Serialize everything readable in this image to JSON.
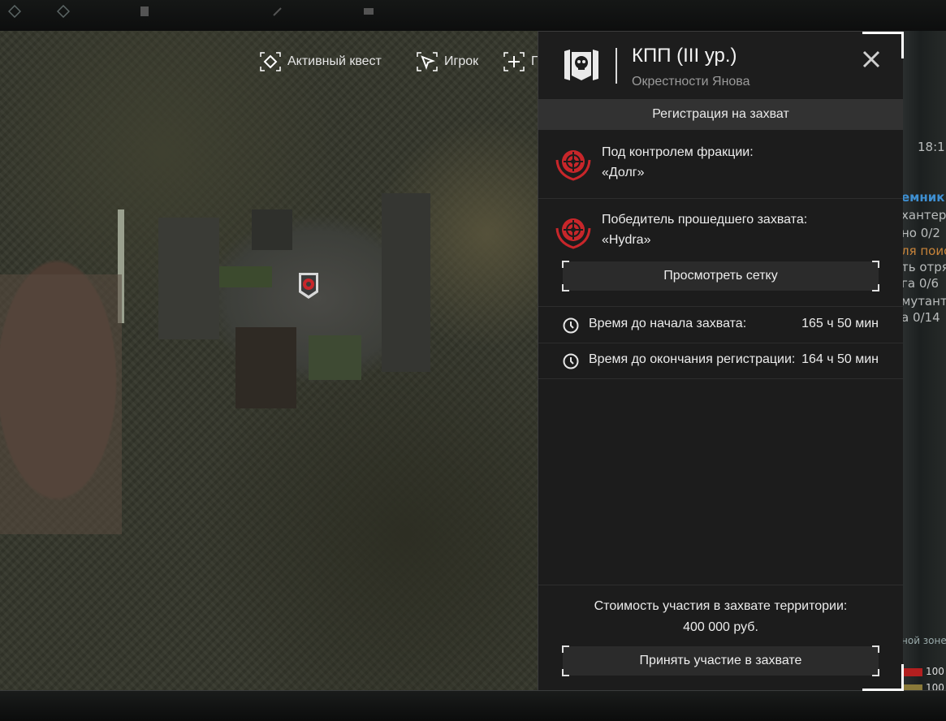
{
  "legend": [
    {
      "label": "Активный квест",
      "icon": "active-quest-icon"
    },
    {
      "label": "Игрок",
      "icon": "player-arrow-icon"
    },
    {
      "label": "Г",
      "icon": "plus-icon"
    }
  ],
  "panel": {
    "title": "КПП (III ур.)",
    "subtitle": "Окрестности Янова",
    "registration_header": "Регистрация на захват",
    "control": {
      "label": "Под контролем фракции:",
      "value": "«Долг»"
    },
    "winner": {
      "label": "Победитель прошедшего захвата:",
      "value": "«Hydra»"
    },
    "view_grid_button": "Просмотреть сетку",
    "timers": [
      {
        "label": "Время до начала захвата:",
        "value": "165 ч 50 мин"
      },
      {
        "label": "Время до окончания регистрации:",
        "value": "164 ч 50 мин"
      }
    ],
    "cost_label": "Стоимость участия в захвате территории:",
    "cost_value": "400 000 руб.",
    "join_button": "Принять участие в захвате"
  },
  "background_fragments": [
    {
      "text": "18:1"
    },
    {
      "text": "емник"
    },
    {
      "text": "хантеро"
    },
    {
      "text": "но 0/2"
    },
    {
      "text": "ля поис"
    },
    {
      "text": "ть отряд"
    },
    {
      "text": "га 0/6"
    },
    {
      "text": "мутант"
    },
    {
      "text": "а 0/14"
    },
    {
      "text": "ной зоне"
    },
    {
      "text": "100"
    },
    {
      "text": "100"
    }
  ],
  "colors": {
    "accent_red": "#c8262a",
    "panel_bg": "#1c1c1c",
    "band_bg": "#323232",
    "button_bg": "#2b2b2b"
  }
}
